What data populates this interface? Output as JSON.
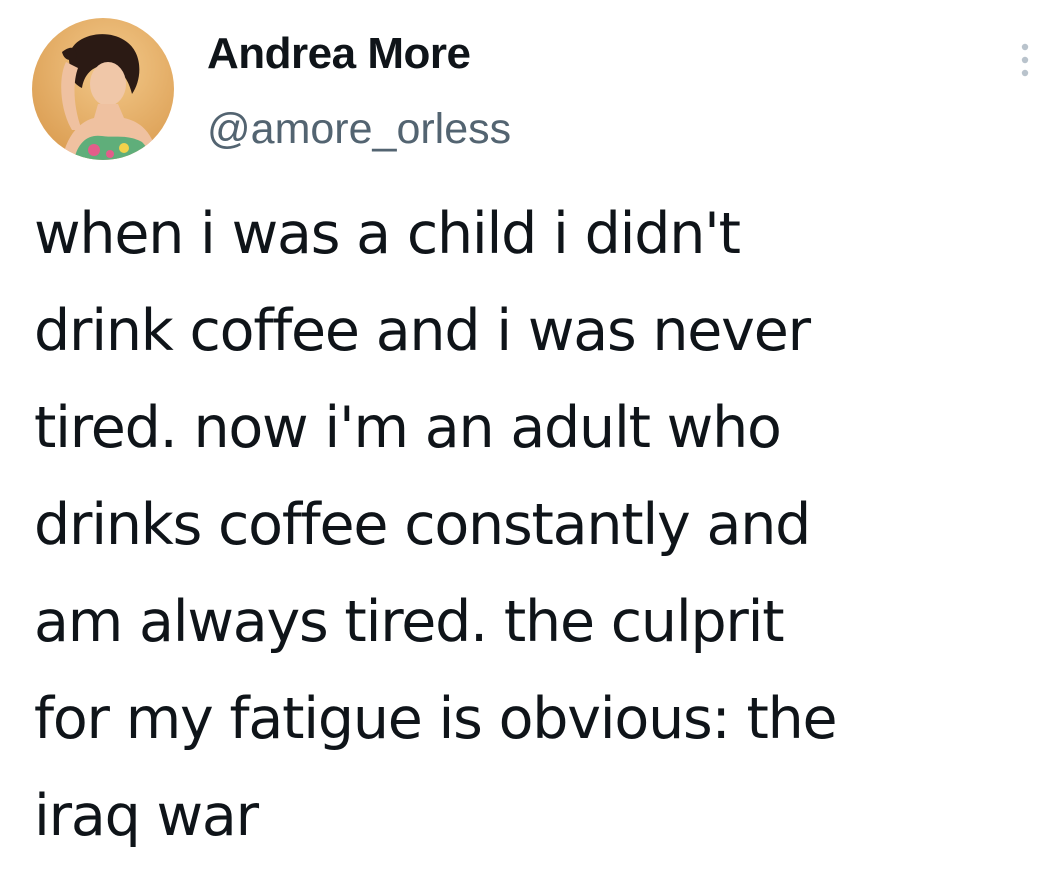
{
  "author": {
    "display_name": "Andrea More",
    "handle": "@amore_orless",
    "avatar_icon": "profile-photo-avatar"
  },
  "menu": {
    "icon": "more-vertical-icon"
  },
  "tweet": {
    "lines": [
      "when i was a child i didn't",
      "drink coffee and i was never",
      "tired. now i'm an adult who",
      "drinks coffee constantly and",
      "am always tired. the culprit",
      "for my fatigue is obvious: the",
      "iraq war"
    ]
  },
  "colors": {
    "text_primary": "#0f1419",
    "text_secondary": "#536471",
    "avatar_background": "#e8b56a"
  }
}
